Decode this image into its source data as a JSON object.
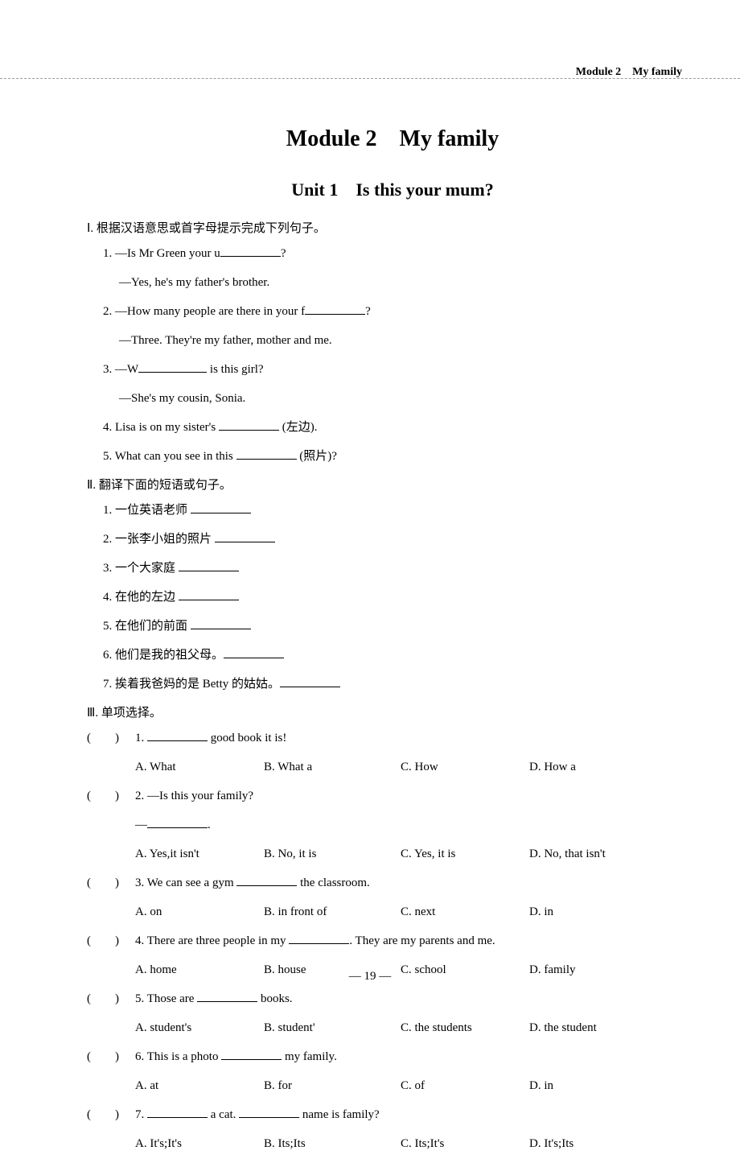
{
  "header": {
    "breadcrumb": "Module 2　My family"
  },
  "titles": {
    "module": "Module 2　My family",
    "unit": "Unit 1　Is this your mum?"
  },
  "section1": {
    "header": "Ⅰ. 根据汉语意思或首字母提示完成下列句子。",
    "q1": {
      "line1a": "1. —Is Mr Green your u",
      "line1b": "?",
      "line2": "—Yes, he's my father's brother."
    },
    "q2": {
      "line1a": "2. —How many people are there in your f",
      "line1b": "?",
      "line2": "—Three. They're my father, mother and me."
    },
    "q3": {
      "line1a": "3. —W",
      "line1b": " is this girl?",
      "line2": "—She's my cousin, Sonia."
    },
    "q4": {
      "a": "4. Lisa is on my sister's ",
      "b": " (左边)."
    },
    "q5": {
      "a": "5. What can you see in this ",
      "b": " (照片)?"
    }
  },
  "section2": {
    "header": "Ⅱ. 翻译下面的短语或句子。",
    "items": [
      "1. 一位英语老师 ",
      "2. 一张李小姐的照片 ",
      "3. 一个大家庭 ",
      "4. 在他的左边 ",
      "5. 在他们的前面 ",
      "6. 他们是我的祖父母。",
      "7. 挨着我爸妈的是 Betty 的姑姑。"
    ]
  },
  "section3": {
    "header": "Ⅲ. 单项选择。",
    "paren": "(　　)",
    "q1": {
      "stem_a": "1. ",
      "stem_b": " good book it is!",
      "opts": [
        "A. What",
        "B. What a",
        "C. How",
        "D. How a"
      ]
    },
    "q2": {
      "stem": "2. —Is this your family?",
      "dash": "—",
      "dot": ".",
      "opts": [
        "A. Yes,it isn't",
        "B. No, it is",
        "C. Yes, it is",
        "D. No, that isn't"
      ]
    },
    "q3": {
      "stem_a": "3. We can see a gym ",
      "stem_b": " the classroom.",
      "opts": [
        "A. on",
        "B. in front of",
        "C. next",
        "D. in"
      ]
    },
    "q4": {
      "stem_a": "4. There are three people in my ",
      "stem_b": ". They are my parents and me.",
      "opts": [
        "A. home",
        "B. house",
        "C. school",
        "D. family"
      ]
    },
    "q5": {
      "stem_a": "5. Those are ",
      "stem_b": " books.",
      "opts": [
        "A. student's",
        "B. student'",
        "C. the students",
        "D. the student"
      ]
    },
    "q6": {
      "stem_a": "6. This is a photo ",
      "stem_b": " my family.",
      "opts": [
        "A. at",
        "B. for",
        "C. of",
        "D. in"
      ]
    },
    "q7": {
      "stem_a": "7. ",
      "stem_b": " a cat. ",
      "stem_c": " name is family?",
      "opts": [
        "A. It's;It's",
        "B. Its;Its",
        "C. Its;It's",
        "D. It's;Its"
      ]
    }
  },
  "pageNumber": "— 19 —"
}
